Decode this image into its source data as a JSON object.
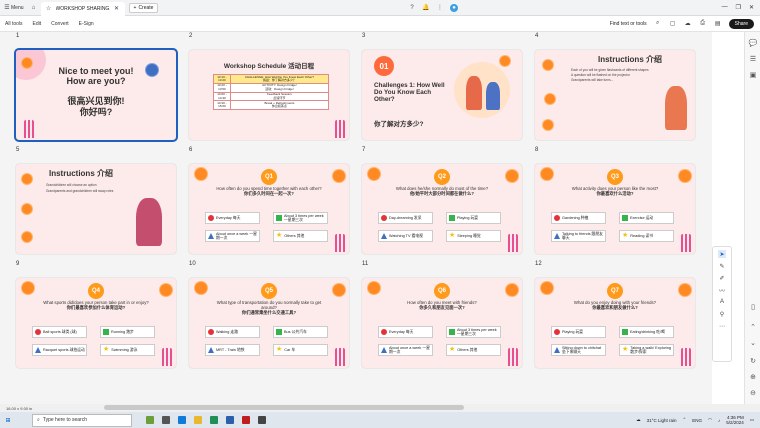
{
  "browser": {
    "menu_label": "Menu",
    "tab_title": "WORKSHOP SHARING...",
    "new_tab_label": "Create"
  },
  "pdf_toolbar": {
    "all_tools": "All tools",
    "edit": "Edit",
    "convert": "Convert",
    "esign": "E-Sign",
    "find_label": "Find text or tools",
    "share_label": "Share"
  },
  "page_numbers": [
    "1",
    "2",
    "3",
    "4",
    "5",
    "6",
    "7",
    "8",
    "9",
    "10",
    "11",
    "12"
  ],
  "slides": {
    "s1": {
      "title_en": "Nice to meet you!\nHow are you?",
      "title_zh": "很高兴见到你!\n你好吗?"
    },
    "s2": {
      "title": "Workshop Schedule 活动日程",
      "rows": [
        [
          "13:10 -\n13:20",
          "CHALLENGE: How Well Do You Know Each Other?\n挑战：你了解对方多少？"
        ],
        [
          "13:20 -\n13:50",
          "ACTIVITY: Design Fridge!\n活动：Design Fridge!"
        ],
        [
          "14:00 -\n14:30",
          "Feedback Session\n反馈环节"
        ],
        [
          "14:30 -\n15:00",
          "Break + Refreshments\n休息和茶点"
        ]
      ]
    },
    "s3": {
      "num": "01",
      "title_en": "Challenges 1: How Well Do You Know Each Other?",
      "title_zh": "你了解对方多少?"
    },
    "s4": {
      "title": "Instructions 介绍",
      "lines": [
        "Each of you will be given flashcards of different shapes",
        "A question will be flashed on the projector",
        "Grandparents will take turns..."
      ]
    },
    "s5": {
      "title": "Instructions 介绍",
      "lines": [
        "Grandchildren will choose an option",
        "Grandparents and grandchildren will swap roles"
      ]
    },
    "s6": {
      "q": "Q1",
      "text_en": "How often do you spend time together with each other?",
      "text_zh": "你们多久时间在一起一次?",
      "opts": [
        "Everyday 每天",
        "About 3 times per week 一星期三次",
        "About once a week 一星期一次",
        "Others 其他"
      ]
    },
    "s7": {
      "q": "Q2",
      "text_en": "What does he/she normally do most of the time?",
      "text_zh": "他/她平时大部分时间都在做什么?",
      "opts": [
        "Day-dreaming 发呆",
        "Playing 玩耍",
        "Watching TV 看电视",
        "Sleeping 睡觉"
      ]
    },
    "s8": {
      "q": "Q3",
      "text_en": "What activity does your person like the most?",
      "text_zh": "你最喜欢什么活动?",
      "opts": [
        "Gardening 种植",
        "Exercise 运动",
        "Talking to friends 跟朋友聊天",
        "Reading 读书"
      ]
    },
    "s9": {
      "q": "Q4",
      "text_en": "What sports did/does your person take part in or enjoy?",
      "text_zh": "你们最喜欢参加什么体育运动?",
      "opts": [
        "Ball sports 球类 (球)",
        "Running 跑步",
        "Racquet sports 球拍运动",
        "Swimming 游泳"
      ]
    },
    "s10": {
      "q": "Q5",
      "text_en": "What type of transportation do you normally take to get around?",
      "text_zh": "你们通常乘坐什么交通工具?",
      "opts": [
        "Walking 走路",
        "Bus 公共汽车",
        "MRT - Train 地铁",
        "Car 车"
      ]
    },
    "s11": {
      "q": "Q6",
      "text_en": "How often do you meet with friends?",
      "text_zh": "你多久和朋友见面一次?",
      "opts": [
        "Everyday 每天",
        "About 3 times per week 一星期三次",
        "About once a week 一星期一次",
        "Others 其他"
      ]
    },
    "s12": {
      "q": "Q7",
      "text_en": "What do you enjoy doing with your friends?",
      "text_zh": "你最喜欢和朋友做什么?",
      "opts": [
        "Playing 玩耍",
        "Eating/drinking 吃/喝",
        "Sitting down to chitchat 坐下来聊天",
        "Taking a walk/ Exploring 散步/探索"
      ]
    }
  },
  "status": {
    "page_size": "16.00 x 9.00 in"
  },
  "taskbar": {
    "search_placeholder": "Type here to search",
    "weather": "31°C Light rain",
    "time": "4:36 PM",
    "date": "5/2/2024",
    "lang": "ENG"
  },
  "colors": {
    "accent": "#ff9a1a",
    "slide_bg": "#fdeaea",
    "selected": "#1f5fbf"
  }
}
